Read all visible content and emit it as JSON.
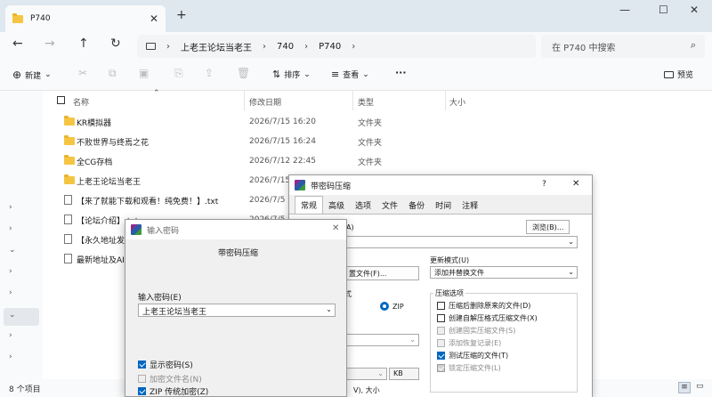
{
  "explorer": {
    "tab_title": "P740",
    "new_tab": "+",
    "window_controls": {
      "minimize": "—",
      "maximize": "☐",
      "close": "✕"
    },
    "nav": {
      "back": "←",
      "forward": "→",
      "up": "↑",
      "refresh": "↻"
    },
    "breadcrumb": [
      "上老王论坛当老王",
      "740",
      "P740"
    ],
    "search_placeholder": "在 P740 中搜索",
    "toolbar": {
      "new_label": "新建",
      "sort_label": "排序",
      "view_label": "查看",
      "more_label": "···",
      "preview_label": "预览"
    },
    "columns": {
      "name": "名称",
      "date": "修改日期",
      "type": "类型",
      "size": "大小"
    },
    "files": [
      {
        "name": "KR模拟器",
        "date": "2026/7/15 16:20",
        "type": "文件夹",
        "kind": "folder"
      },
      {
        "name": "不败世界与终焉之花",
        "date": "2026/7/15 16:24",
        "type": "文件夹",
        "kind": "folder"
      },
      {
        "name": "全CG存档",
        "date": "2026/7/12 22:45",
        "type": "文件夹",
        "kind": "folder"
      },
      {
        "name": "上老王论坛当老王",
        "date": "2026/7/15",
        "type": "",
        "kind": "folder"
      },
      {
        "name": "【来了就能下载和观看！纯免费！】.txt",
        "date": "2026/7/5",
        "type": "",
        "kind": "txt"
      },
      {
        "name": "【论坛介绍】.txt",
        "date": "2026/7/5",
        "type": "",
        "kind": "txt"
      },
      {
        "name": "【永久地址发",
        "date": "",
        "type": "",
        "kind": "txt"
      },
      {
        "name": "最新地址及AI",
        "date": "",
        "type": "",
        "kind": "txt"
      }
    ],
    "status": "8 个项目"
  },
  "compress_dialog": {
    "title": "带密码压缩",
    "help": "?",
    "close": "✕",
    "tabs": [
      "常规",
      "高级",
      "选项",
      "文件",
      "备份",
      "时间",
      "注释"
    ],
    "browse_button": "浏览(B)...",
    "archive_name_suffix": "A)",
    "update_mode_label": "更新模式(U)",
    "update_mode_value": "添加并替换文件",
    "profile_button": "置文件(F)...",
    "format_label_partial": "式",
    "format_zip": "ZIP",
    "options_group": "压缩选项",
    "options": [
      {
        "label": "压缩后删除原来的文件(D)",
        "state": "unchecked"
      },
      {
        "label": "创建自解压格式压缩文件(X)",
        "state": "unchecked"
      },
      {
        "label": "创建固实压缩文件(S)",
        "state": "disabled-unchecked"
      },
      {
        "label": "添加恢复记录(E)",
        "state": "disabled-unchecked"
      },
      {
        "label": "测试压缩的文件(T)",
        "state": "checked"
      },
      {
        "label": "锁定压缩文件(L)",
        "state": "disabled-checked"
      }
    ],
    "kb_label": "KB",
    "size_label": "V), 大小"
  },
  "password_dialog": {
    "title": "输入密码",
    "close": "✕",
    "heading": "带密码压缩",
    "password_label": "输入密码(E)",
    "password_value": "上老王论坛当老王",
    "checks": [
      {
        "label": "显示密码(S)",
        "state": "checked"
      },
      {
        "label": "加密文件名(N)",
        "state": "unchecked"
      },
      {
        "label": "ZIP 传统加密(Z)",
        "state": "checked"
      }
    ]
  }
}
